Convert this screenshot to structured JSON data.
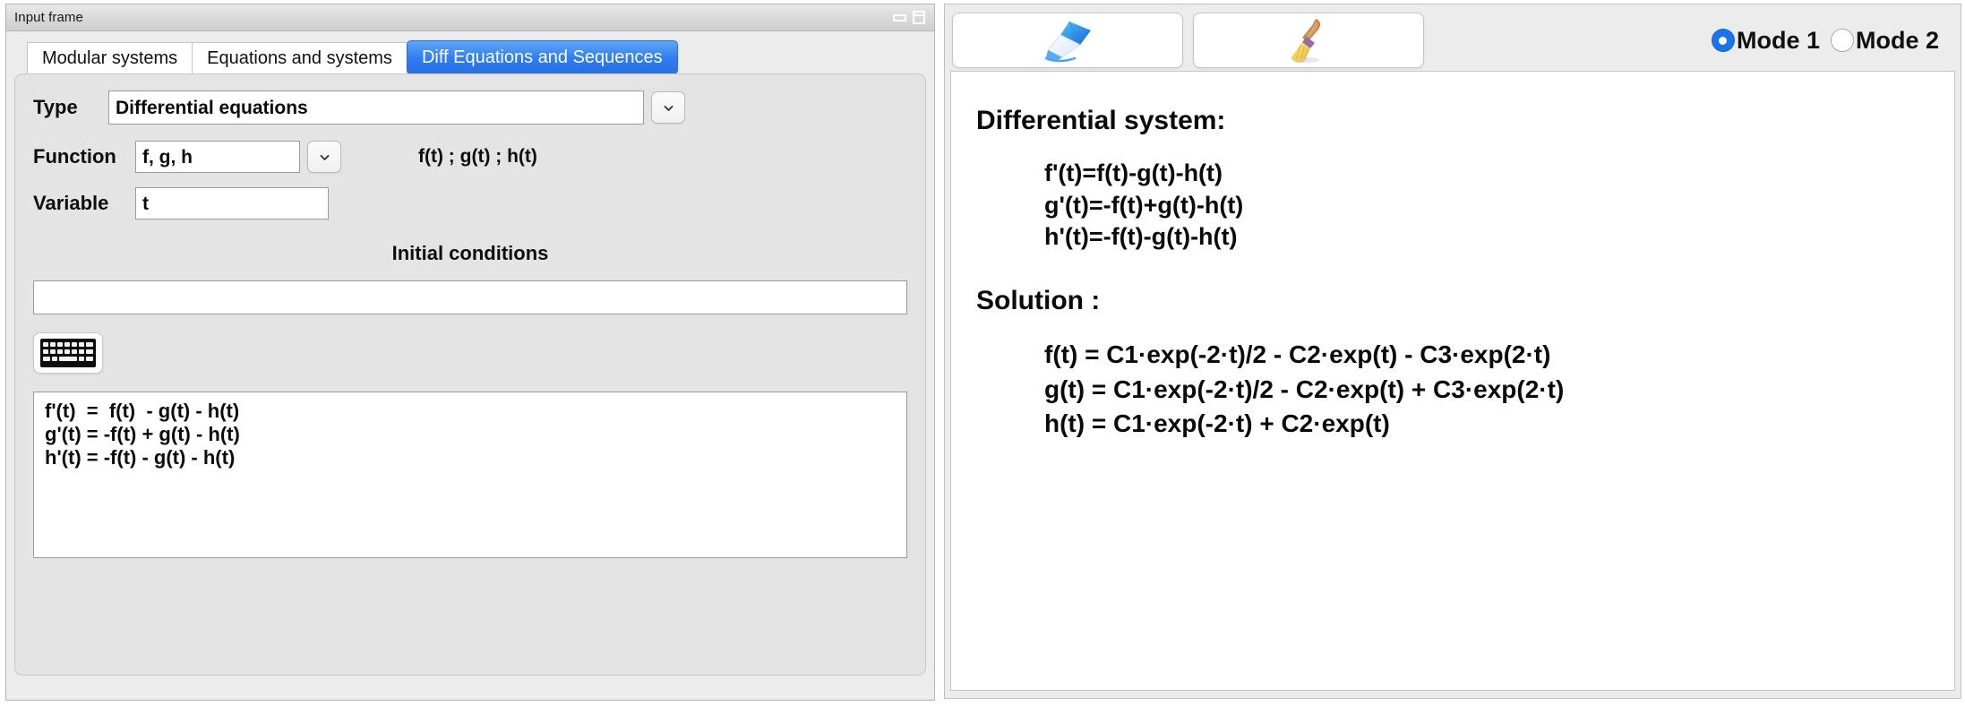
{
  "input_window": {
    "title": "Input frame",
    "window_buttons": {
      "minimize": "minimize-icon",
      "maximize": "maximize-icon"
    },
    "tabs": [
      {
        "label": "Modular systems",
        "active": false
      },
      {
        "label": "Equations and systems",
        "active": false
      },
      {
        "label": "Diff Equations and Sequences",
        "active": true
      }
    ],
    "type_field": {
      "label": "Type",
      "value": "Differential equations",
      "dropdown_icon": "chevron-down-icon"
    },
    "function_field": {
      "label": "Function",
      "value": "f, g, h",
      "dropdown_icon": "chevron-down-icon",
      "hint": "f(t) ; g(t) ; h(t)"
    },
    "variable_field": {
      "label": "Variable",
      "value": "t"
    },
    "initial_conditions": {
      "title": "Initial conditions",
      "value": "",
      "placeholder": ""
    },
    "keyboard_button": {
      "icon": "keyboard-icon"
    },
    "equations_editor": {
      "value": "f'(t)  =  f(t)  - g(t) - h(t)\ng'(t) = -f(t) + g(t) - h(t)\nh'(t) = -f(t) - g(t) - h(t)"
    }
  },
  "output_panel": {
    "toolbar": {
      "compute_button_icon": "blue-pen-icon",
      "clear_button_icon": "broom-icon",
      "modes": [
        {
          "label": "Mode 1",
          "selected": true
        },
        {
          "label": "Mode 2",
          "selected": false
        }
      ]
    },
    "system_heading": "Differential system:",
    "system_equations": "f'(t)=f(t)-g(t)-h(t)\ng'(t)=-f(t)+g(t)-h(t)\nh'(t)=-f(t)-g(t)-h(t)",
    "solution_heading": "Solution :",
    "solution_equations": "f(t) = C1·exp(-2·t)/2 - C2·exp(t) - C3·exp(2·t)\ng(t) = C1·exp(-2·t)/2 - C2·exp(t) + C3·exp(2·t)\nh(t) = C1·exp(-2·t) + C2·exp(t)"
  },
  "colors": {
    "active_tab": "#2d7cf0",
    "radio_selected": "#1a73e8",
    "window_bg": "#ececec",
    "panel_bg": "#e4e4e4"
  }
}
